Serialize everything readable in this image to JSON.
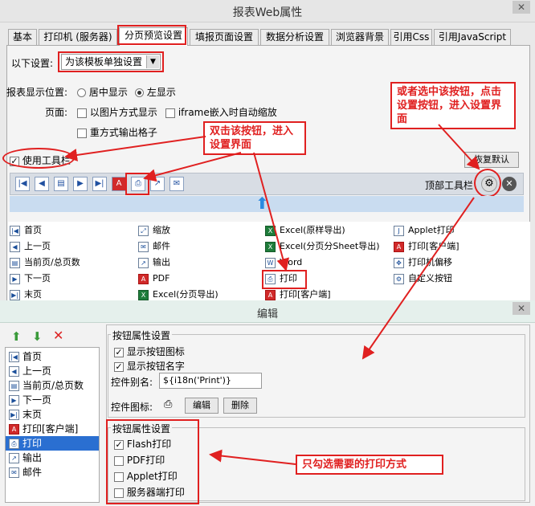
{
  "window": {
    "title": "报表Web属性",
    "close": "✕"
  },
  "tabs": [
    "基本",
    "打印机 (服务器)",
    "分页预览设置",
    "填报页面设置",
    "数据分析设置",
    "浏览器背景",
    "引用Css",
    "引用JavaScript"
  ],
  "settings": {
    "label": "以下设置:",
    "select_value": "为该模板单独设置",
    "position_label": "报表显示位置:",
    "center": "居中显示",
    "left": "左显示",
    "page_label": "页面:",
    "image_mode": "以图片方式显示",
    "iframe": "iframe嵌入时自动缩放",
    "repeat_cells": "重方式输出格子",
    "use_toolbar": "使用工具栏",
    "restore_default": "恢复默认",
    "top_toolbar": "顶部工具栏"
  },
  "annotations": {
    "dblclick": "双击该按钮，进入设置界面",
    "or_select": "或者选中该按钮，点击设置按钮，进入设置界面",
    "only_check": "只勾选需要的打印方式"
  },
  "grid": {
    "col1": [
      "首页",
      "上一页",
      "当前页/总页数",
      "下一页",
      "末页"
    ],
    "col2": [
      "缩放",
      "邮件",
      "输出",
      "PDF",
      "Excel(分页导出)"
    ],
    "col3": [
      "Excel(原样导出)",
      "Excel(分页分Sheet导出)",
      "Word",
      "打印",
      "打印[客户端]"
    ],
    "col4": [
      "Applet打印",
      "打印[客户端]",
      "打印机偏移",
      "自定义按钮"
    ]
  },
  "editor": {
    "title": "编辑",
    "list": [
      "首页",
      "上一页",
      "当前页/总页数",
      "下一页",
      "末页",
      "打印[客户端]",
      "打印",
      "输出",
      "邮件"
    ],
    "selected": "打印",
    "group1_title": "按钮属性设置",
    "show_icon": "显示按钮图标",
    "show_name": "显示按钮名字",
    "alias_label": "控件别名:",
    "alias_value": "${i18n('Print')}",
    "icon_label": "控件图标:",
    "edit_btn": "编辑",
    "delete_btn": "删除",
    "group2_title": "按钮属性设置",
    "print_options": [
      "Flash打印",
      "PDF打印",
      "Applet打印",
      "服务器端打印"
    ],
    "print_checked": [
      true,
      false,
      false,
      false
    ]
  },
  "colors": {
    "accent_red": "#e02020",
    "selection_blue": "#2a6fd1"
  }
}
